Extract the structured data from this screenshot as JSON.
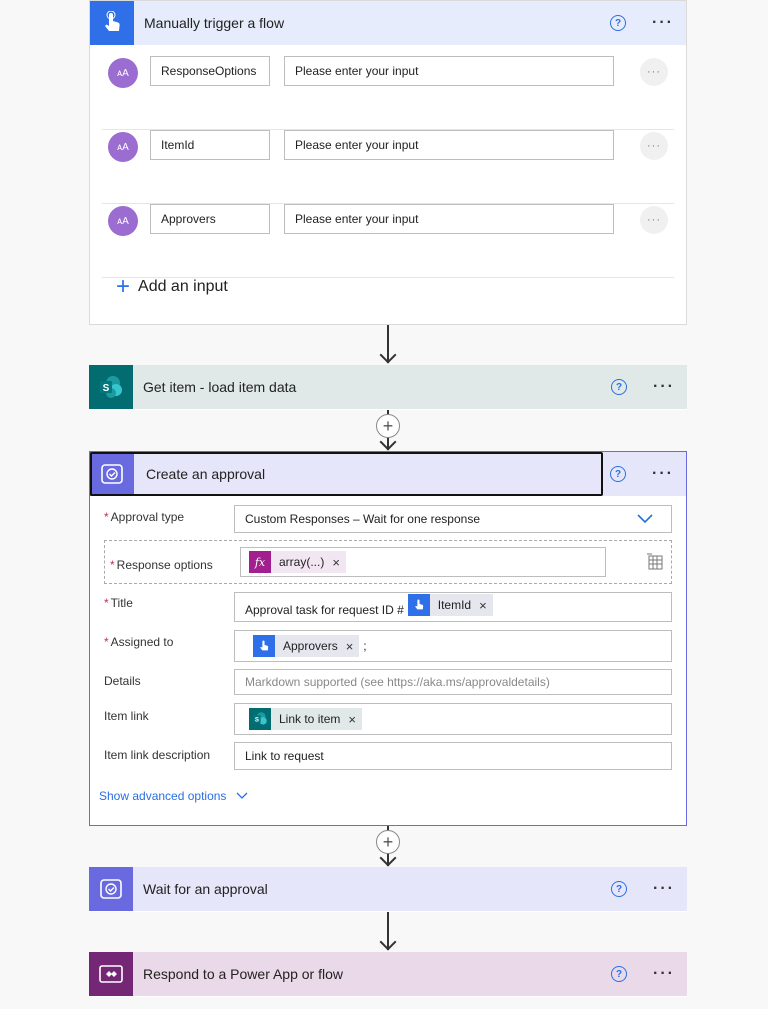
{
  "trigger": {
    "title": "Manually trigger a flow",
    "inputs": [
      {
        "name": "ResponseOptions",
        "placeholder": "Please enter your input"
      },
      {
        "name": "ItemId",
        "placeholder": "Please enter your input"
      },
      {
        "name": "Approvers",
        "placeholder": "Please enter your input"
      }
    ],
    "add_input": "Add an input",
    "more": "···",
    "help": "?",
    "avatar_text": "ᴀA"
  },
  "get_item": {
    "title": "Get item - load item data"
  },
  "approval": {
    "title": "Create an approval",
    "approval_type_label": "Approval type",
    "approval_type_value": "Custom Responses – Wait for one response",
    "response_options_label": "Response options",
    "response_options_token": "array(...)",
    "title_label": "Title",
    "title_prefix": "Approval task for request ID #",
    "title_token": "ItemId",
    "assigned_label": "Assigned to",
    "assigned_token": "Approvers",
    "assigned_suffix": ";",
    "details_label": "Details",
    "details_placeholder": "Markdown supported (see https://aka.ms/approvaldetails)",
    "item_link_label": "Item link",
    "item_link_token": "Link to item",
    "item_link_desc_label": "Item link description",
    "item_link_desc_value": "Link to request",
    "show_advanced": "Show advanced options",
    "required_mark": "*",
    "token_close": "×"
  },
  "wait": {
    "title": "Wait for an approval"
  },
  "respond": {
    "title": "Respond to a Power App or flow"
  },
  "colors": {
    "trigger_blue": "#2f6fe8",
    "trigger_header_bg": "#e6ecfb",
    "sharepoint_green": "#036c70",
    "getitem_header_bg": "#e1e8e8",
    "approval_purple": "#6a6ae0",
    "approval_header_bg": "#e6e6fa",
    "respond_purple": "#742774",
    "respond_header_bg": "#ead9e8",
    "link_blue": "#2a6fe0",
    "required_red": "#c4314b"
  }
}
